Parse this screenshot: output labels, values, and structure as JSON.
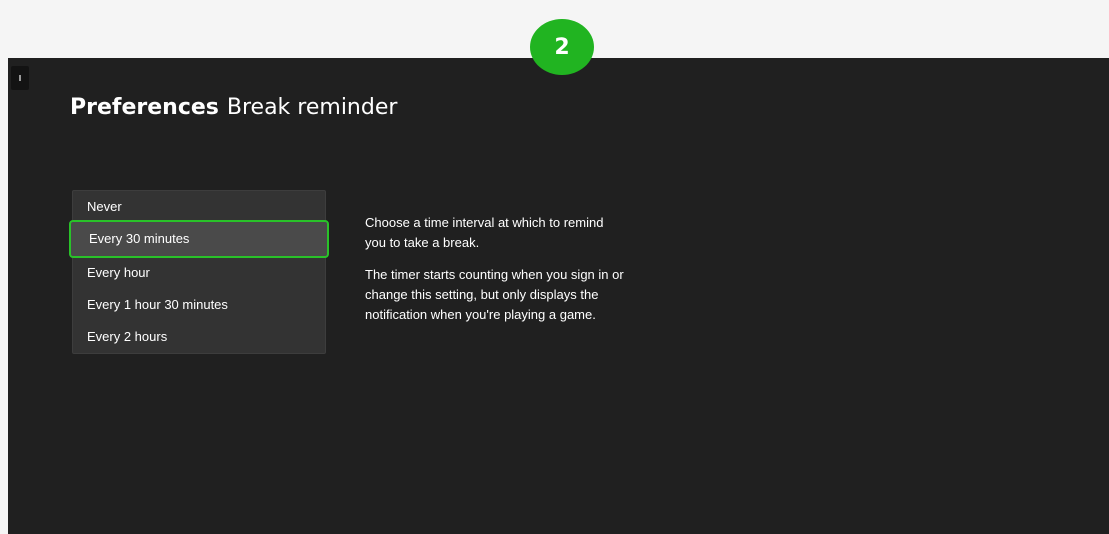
{
  "step": {
    "number": "2",
    "color": "#21b421"
  },
  "header": {
    "section": "Preferences",
    "page": "Break reminder"
  },
  "reminder_options": {
    "items": [
      {
        "label": "Never",
        "selected": false
      },
      {
        "label": "Every 30 minutes",
        "selected": true
      },
      {
        "label": "Every hour",
        "selected": false
      },
      {
        "label": "Every 1 hour 30 minutes",
        "selected": false
      },
      {
        "label": "Every 2 hours",
        "selected": false
      }
    ],
    "selected_value": "Every 30 minutes",
    "focus_color": "#29c229"
  },
  "description": {
    "paragraph1": "Choose a time interval at which to remind you to take a break.",
    "paragraph2": "The timer starts counting when you sign in or change this setting, but only displays the notification when you're playing a game."
  },
  "theme": {
    "background": "#202020",
    "outer_background": "#f5f5f5",
    "list_background": "#333333"
  }
}
